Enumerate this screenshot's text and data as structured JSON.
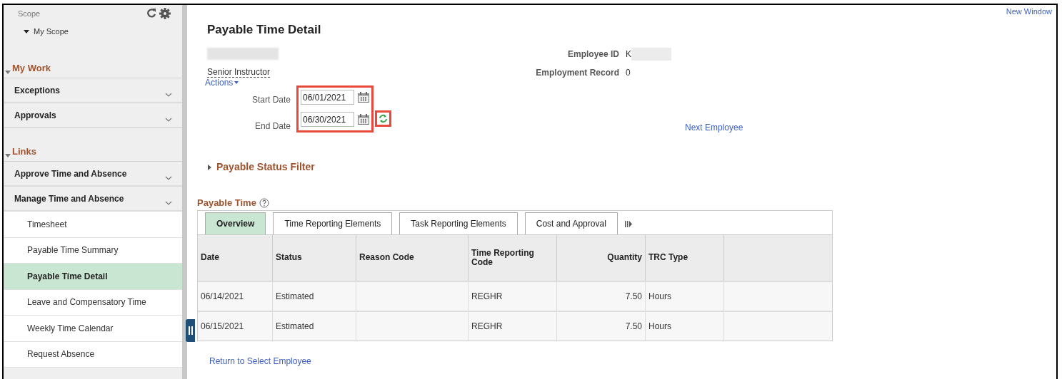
{
  "sidebar": {
    "scope_label": "Scope",
    "scope_item": {
      "label": "My Scope",
      "expanded": true
    },
    "sections": [
      {
        "title": "My Work",
        "expanded": true,
        "items": [
          {
            "label": "Exceptions",
            "expanded": false
          },
          {
            "label": "Approvals",
            "expanded": false
          }
        ]
      },
      {
        "title": "Links",
        "expanded": true,
        "items": [
          {
            "label": "Approve Time and Absence",
            "expanded": false
          },
          {
            "label": "Manage Time and Absence",
            "expanded": true,
            "children": [
              {
                "label": "Timesheet",
                "selected": false
              },
              {
                "label": "Payable Time Summary",
                "selected": false
              },
              {
                "label": "Payable Time Detail",
                "selected": true
              },
              {
                "label": "Leave and Compensatory Time",
                "selected": false
              },
              {
                "label": "Weekly Time Calendar",
                "selected": false
              },
              {
                "label": "Request Absence",
                "selected": false
              }
            ]
          }
        ]
      }
    ]
  },
  "new_window": "New Window",
  "page_title": "Payable Time Detail",
  "job_title": "Senior Instructor",
  "actions": "Actions",
  "employee_id": {
    "label": "Employee ID",
    "value": "K"
  },
  "employment_record": {
    "label": "Employment Record",
    "value": "0"
  },
  "dates": {
    "highlighted": true,
    "start_label": "Start Date",
    "start_value": "06/01/2021",
    "end_label": "End Date",
    "end_value": "06/30/2021"
  },
  "next_employee": "Next Employee",
  "status_filter": {
    "label": "Payable Status Filter",
    "expanded": false
  },
  "grid": {
    "title": "Payable Time",
    "tabs": [
      {
        "label": "Overview",
        "selected": true
      },
      {
        "label": "Time Reporting Elements",
        "selected": false
      },
      {
        "label": "Task Reporting Elements",
        "selected": false
      },
      {
        "label": "Cost and Approval",
        "selected": false
      }
    ],
    "columns": [
      "Date",
      "Status",
      "Reason Code",
      "Time Reporting Code",
      "Quantity",
      "TRC Type"
    ],
    "rows": [
      [
        "06/14/2021",
        "Estimated",
        "",
        "REGHR",
        "7.50",
        "Hours"
      ],
      [
        "06/15/2021",
        "Estimated",
        "",
        "REGHR",
        "7.50",
        "Hours"
      ]
    ]
  },
  "return_link": "Return to Select Employee"
}
